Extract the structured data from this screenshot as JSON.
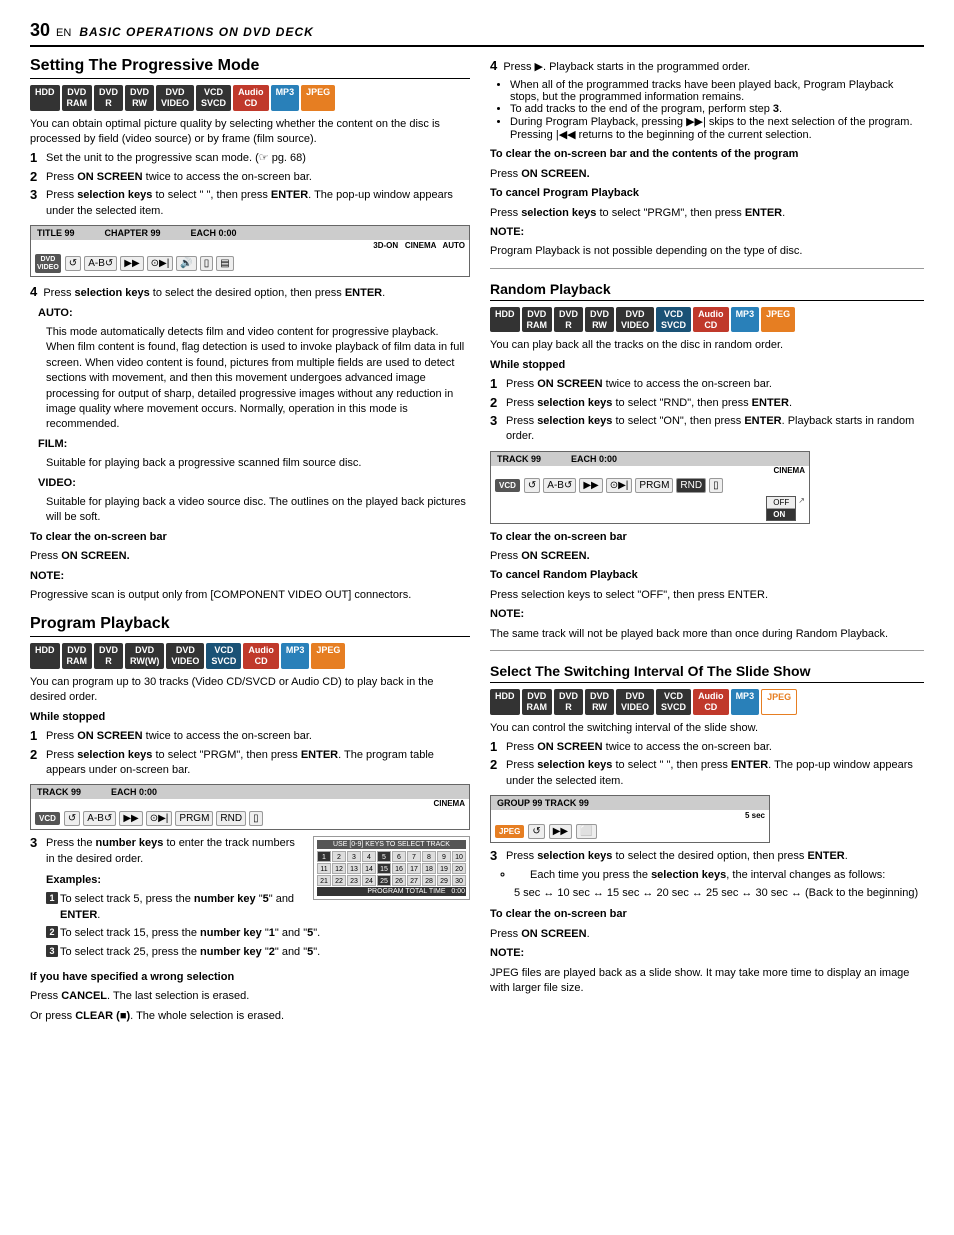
{
  "header": {
    "page_number": "30",
    "en_label": "EN",
    "title": "BASIC OPERATIONS ON DVD DECK"
  },
  "section_progressive": {
    "title": "Setting The Progressive Mode",
    "badges": [
      "HDD",
      "DVD RAM",
      "DVD R",
      "DVD RW",
      "DVD VIDEO",
      "VCD SVCD",
      "Audio CD",
      "MP3",
      "JPEG"
    ],
    "intro": "You can obtain optimal picture quality by selecting whether the content on the disc is processed by field (video source) or by frame (film source).",
    "steps": [
      "Set the unit to the progressive scan mode. (☞ pg. 68)",
      "Press ON SCREEN twice to access the on-screen bar.",
      "Press selection keys to select \"  \", then press ENTER. The pop-up window appears under the selected item."
    ],
    "bar": {
      "header_cols": [
        "TITLE 99",
        "CHAPTER 99",
        "EACH 0:00"
      ],
      "right_labels": [
        "3D-ON",
        "CINEMA",
        "AUTO"
      ],
      "device_label": "DVD VIDEO",
      "icons": [
        "↺",
        "A-B↺",
        "▶▶",
        "⊙▶|",
        "🔊",
        "▯",
        "▤"
      ]
    },
    "step4": "Press selection keys to select the desired option, then press ENTER.",
    "auto": {
      "label": "AUTO:",
      "body": "This mode automatically detects film and video content for progressive playback. When film content is found, flag detection is used to invoke playback of film data in full screen. When video content is found, pictures from multiple fields are used to detect sections with movement, and then this movement undergoes advanced image processing for output of sharp, detailed progressive images without any reduction in image quality where movement occurs. Normally, operation in this mode is recommended."
    },
    "film": {
      "label": "FILM:",
      "body": "Suitable for playing back a progressive scanned film source disc."
    },
    "video": {
      "label": "VIDEO:",
      "body": "Suitable for playing back a video source disc. The outlines on the played back pictures will be soft."
    },
    "clear_bar_head": "To clear the on-screen bar",
    "clear_bar_body": "Press ON SCREEN.",
    "note_head": "NOTE:",
    "note_body": "Progressive scan is output only from [COMPONENT VIDEO OUT] connectors."
  },
  "section_program": {
    "title": "Program Playback",
    "badges": [
      "HDD",
      "DVD RAM",
      "DVD R",
      "DVD RW(W)",
      "DVD VIDEO",
      "VCD SVCD",
      "Audio CD",
      "MP3",
      "JPEG"
    ],
    "intro": "You can program up to 30 tracks (Video CD/SVCD or Audio CD) to play back in the desired order.",
    "while_stopped": "While stopped",
    "steps": [
      "Press ON SCREEN twice to access the on-screen bar.",
      "Press selection keys to select \"PRGM\", then press ENTER. The program table appears under on-screen bar."
    ],
    "bar": {
      "header_cols": [
        "TRACK 99",
        "EACH 0:00"
      ],
      "cinema_label": "CINEMA",
      "device_label": "VCD",
      "icons": [
        "↺",
        "A-B↺",
        "▶▶",
        "⊙▶|",
        "PRGM",
        "RND",
        "▯"
      ]
    },
    "step3": "Press the number keys to enter the track numbers in the desired order.",
    "examples_label": "Examples:",
    "examples": [
      "To select track 5, press the number key \"5\" and ENTER.",
      "To select track 15, press the number key \"1\" and \"5\".",
      "To select track 25, press the number key \"2\" and \"5\"."
    ],
    "numgrid_label": "USE [0-9] KEYS TO SELECT TRACK",
    "numgrid_rows": [
      [
        "1",
        "2",
        "3",
        "4",
        "5",
        "6",
        "7",
        "8",
        "9",
        "10"
      ],
      [
        "11",
        "12",
        "13",
        "14",
        "15",
        "16",
        "17",
        "18",
        "19",
        "20"
      ],
      [
        "21",
        "22",
        "23",
        "24",
        "25",
        "26",
        "27",
        "28",
        "29",
        "30"
      ]
    ],
    "numgrid_total_label": "PROGRAM TOTAL TIME",
    "numgrid_total_value": "0:00",
    "wrong_head": "If you have specified a wrong selection",
    "wrong_body1": "Press CANCEL. The last selection is erased.",
    "wrong_body2": "Or press CLEAR (■). The whole selection is erased."
  },
  "section_program_right": {
    "step4_intro": "Press ▶. Playback starts in the programmed order.",
    "bullets": [
      "When all of the programmed tracks have been played back, Program Playback stops, but the programmed information remains.",
      "To add tracks to the end of the program, perform step 3.",
      "During Program Playback, pressing ▶▶| skips to the next selection of the program. Pressing |◀◀ returns to the beginning of the current selection."
    ],
    "clear_screen_head": "To clear the on-screen bar and the contents of the program",
    "clear_screen_body": "Press ON SCREEN.",
    "cancel_head": "To cancel Program Playback",
    "cancel_body": "Press selection keys to select \"PRGM\", then press ENTER.",
    "note_head": "NOTE:",
    "note_body": "Program Playback is not possible depending on the type of disc."
  },
  "section_random": {
    "title": "Random Playback",
    "badges": [
      "HDD",
      "DVD RAM",
      "DVD R",
      "DVD RW",
      "DVD VIDEO",
      "VCD SVCD",
      "Audio CD",
      "MP3",
      "JPEG"
    ],
    "intro": "You can play back all the tracks on the disc in random order.",
    "while_stopped": "While stopped",
    "steps": [
      "Press ON SCREEN twice to access the on-screen bar.",
      "Press selection keys to select \"RND\", then press ENTER.",
      "Press selection keys to select \"ON\", then press ENTER. Playback starts in random order."
    ],
    "bar": {
      "header_cols": [
        "TRACK 99",
        "EACH 0:00"
      ],
      "cinema_label": "CINEMA",
      "device_label": "VCD",
      "icons": [
        "↺",
        "A-B↺",
        "▶▶",
        "⊙▶|",
        "PRGM",
        "RND",
        "▯"
      ],
      "offon": [
        "OFF",
        "ON"
      ]
    },
    "clear_bar_head": "To clear the on-screen bar",
    "clear_bar_body": "Press ON SCREEN.",
    "cancel_head": "To cancel Random Playback",
    "cancel_body": "Press selection keys to select \"OFF\", then press ENTER.",
    "note_head": "NOTE:",
    "note_body": "The same track will not be played back more than once during Random Playback."
  },
  "section_slideshow": {
    "title": "Select The Switching Interval Of The Slide Show",
    "badges": [
      "HDD",
      "DVD RAM",
      "DVD R",
      "DVD RW",
      "DVD VIDEO",
      "VCD SVCD",
      "Audio CD",
      "MP3",
      "JPEG"
    ],
    "intro": "You can control the switching interval of the slide show.",
    "steps": [
      "Press ON SCREEN twice to access the on-screen bar.",
      "Press selection keys to select \"  \", then press ENTER. The pop-up window appears under the selected item."
    ],
    "bar": {
      "header": "GROUP 99  TRACK 99",
      "sec_label": "5 sec",
      "device_label": "JPEG",
      "icons": [
        "↺",
        "▶▶",
        "⬜"
      ]
    },
    "step3": "Press selection keys to select the desired option, then press ENTER.",
    "bullets": [
      "Each time you press the selection keys, the interval changes as follows:"
    ],
    "interval_sequence": "5 sec ↔ 10 sec ↔ 15 sec ↔ 20 sec ↔ 25 sec ↔ 30 sec ↔ (Back to the beginning)",
    "clear_bar_head": "To clear the on-screen bar",
    "clear_bar_body": "Press ON SCREEN.",
    "note_head": "NOTE:",
    "note_body": "JPEG files are played back as a slide show. It may take more time to display an image with larger file size."
  }
}
